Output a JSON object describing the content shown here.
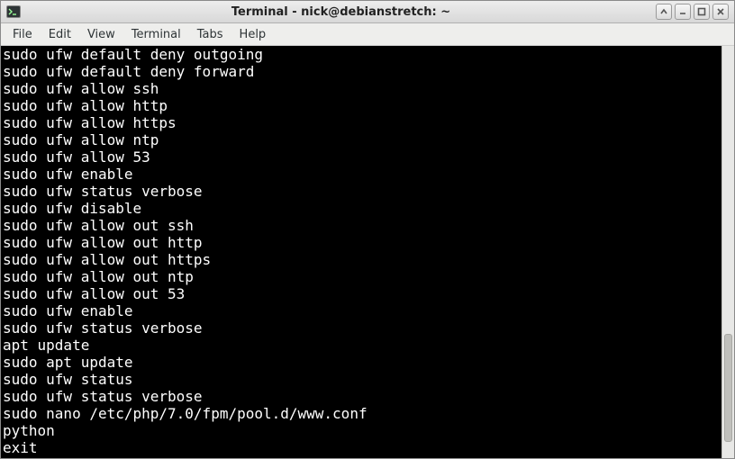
{
  "window": {
    "title": "Terminal - nick@debianstretch: ~"
  },
  "menubar": {
    "items": [
      {
        "label": "File"
      },
      {
        "label": "Edit"
      },
      {
        "label": "View"
      },
      {
        "label": "Terminal"
      },
      {
        "label": "Tabs"
      },
      {
        "label": "Help"
      }
    ]
  },
  "terminal": {
    "lines": [
      "sudo ufw default deny outgoing",
      "sudo ufw default deny forward",
      "sudo ufw allow ssh",
      "sudo ufw allow http",
      "sudo ufw allow https",
      "sudo ufw allow ntp",
      "sudo ufw allow 53",
      "sudo ufw enable",
      "sudo ufw status verbose",
      "sudo ufw disable",
      "sudo ufw allow out ssh",
      "sudo ufw allow out http",
      "sudo ufw allow out https",
      "sudo ufw allow out ntp",
      "sudo ufw allow out 53",
      "sudo ufw enable",
      "sudo ufw status verbose",
      "apt update",
      "sudo apt update",
      "sudo ufw status",
      "sudo ufw status verbose",
      "sudo nano /etc/php/7.0/fpm/pool.d/www.conf",
      "python",
      "exit"
    ]
  }
}
